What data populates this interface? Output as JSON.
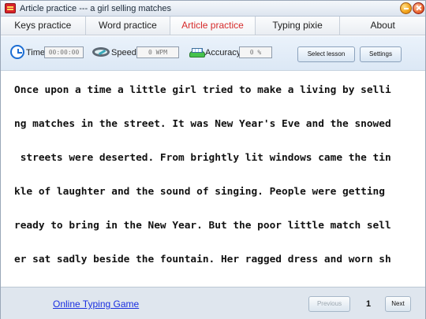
{
  "window": {
    "title": "Article practice --- a girl selling matches"
  },
  "tabs": [
    {
      "label": "Keys practice"
    },
    {
      "label": "Word practice"
    },
    {
      "label": "Article practice"
    },
    {
      "label": "Typing pixie"
    },
    {
      "label": "About"
    }
  ],
  "stats": {
    "time_label": "Time",
    "time_value": "00:00:00",
    "speed_label": "Speed",
    "speed_value": "0 WPM",
    "accuracy_label": "Accuracy",
    "accuracy_value": "0 %"
  },
  "buttons": {
    "select_lesson": "Select lesson",
    "settings": "Settings"
  },
  "article": {
    "lines": [
      "Once upon a time a little girl tried to make a living by selli",
      "ng matches in the street. It was New Year's Eve and the snowed",
      " streets were deserted. From brightly lit windows came the tin",
      "kle of laughter and the sound of singing. People were getting ",
      "ready to bring in the New Year. But the poor little match sell",
      "er sat sadly beside the fountain. Her ragged dress and worn sh"
    ]
  },
  "footer": {
    "link": "Online Typing Game",
    "previous": "Previous",
    "page": "1",
    "next": "Next"
  }
}
